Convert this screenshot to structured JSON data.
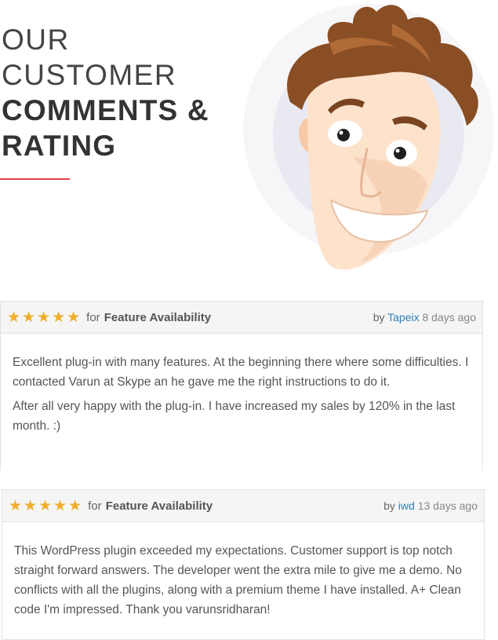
{
  "heading": {
    "line1": "OUR",
    "line2": "CUSTOMER",
    "line3": "COMMENTS &",
    "line4": "RATING"
  },
  "colors": {
    "accent": "#e0424e",
    "star": "#f0ad2b",
    "link": "#2b7fbd"
  },
  "reviews": [
    {
      "stars": "★★★★★",
      "rating": 5,
      "for_label": "for",
      "aspect": "Feature Availability",
      "by_label": "by",
      "author": "Tapeix",
      "ago": "8 days ago",
      "paragraphs": [
        "Excellent plug-in with many features. At the beginning there where some difficulties. I contacted Varun at Skype an he gave me the right instructions to do it.",
        "After all very happy with the plug-in. I have increased my sales by 120% in the last month. :)"
      ]
    },
    {
      "stars": "★★★★★",
      "rating": 5,
      "for_label": "for",
      "aspect": "Feature Availability",
      "by_label": "by",
      "author": "iwd",
      "ago": "13 days ago",
      "paragraphs": [
        "This WordPress plugin exceeded my expectations. Customer support is top notch straight forward answers. The developer went the extra mile to give me a demo. No conflicts with all the plugins, along with a premium theme I have installed. A+ Clean code I'm impressed. Thank you varunsridharan!"
      ]
    }
  ]
}
